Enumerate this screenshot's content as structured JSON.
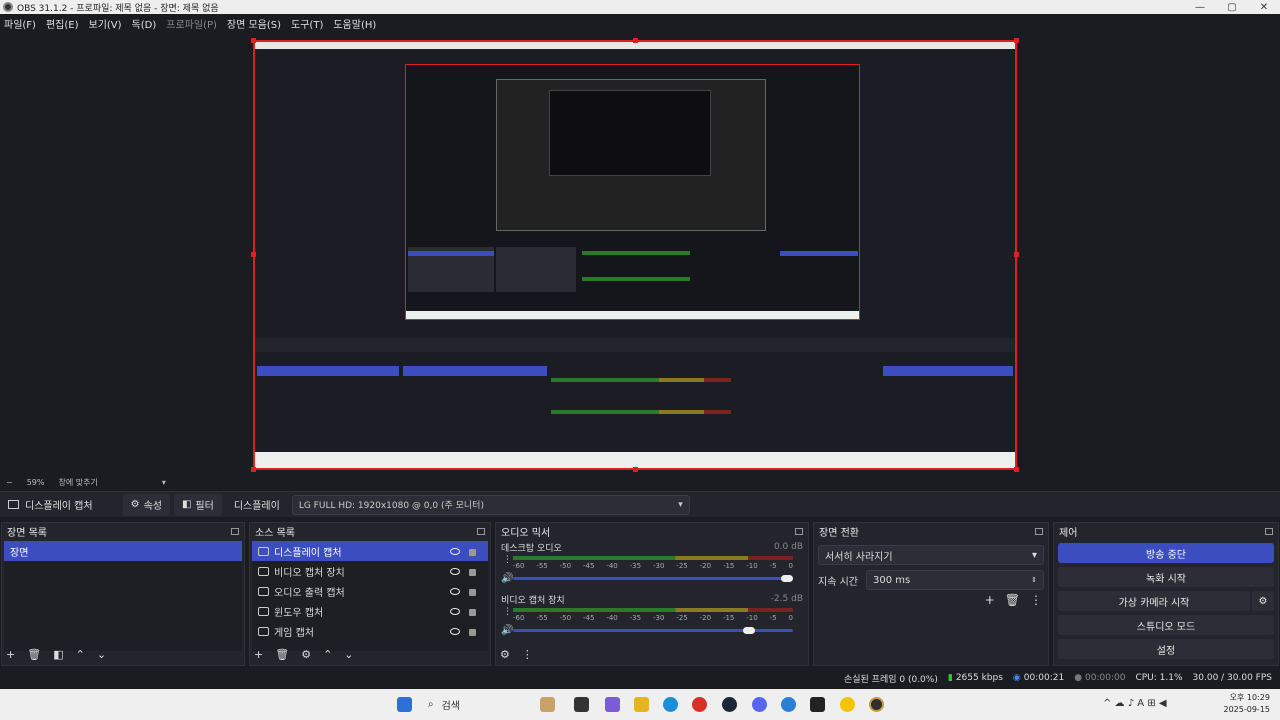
{
  "window": {
    "title": "OBS 31.1.2 - 프로파일: 제목 없음 - 장면: 제목 없음"
  },
  "menu": [
    {
      "label": "파일(F)",
      "dim": false
    },
    {
      "label": "편집(E)",
      "dim": false
    },
    {
      "label": "보기(V)",
      "dim": false
    },
    {
      "label": "독(D)",
      "dim": false
    },
    {
      "label": "프로파일(P)",
      "dim": true
    },
    {
      "label": "장면 모음(S)",
      "dim": false
    },
    {
      "label": "도구(T)",
      "dim": false
    },
    {
      "label": "도움말(H)",
      "dim": false
    }
  ],
  "zoom": {
    "value": "59%",
    "mode": "창에 맞추기"
  },
  "source_bar": {
    "source_name": "디스플레이 캡처",
    "properties": "속성",
    "filters": "필터",
    "display_label": "디스플레이",
    "display_value": "LG FULL HD: 1920x1080 @ 0,0 (주 모니터)"
  },
  "scenes": {
    "title": "장면 목록",
    "items": [
      "장면"
    ]
  },
  "sources": {
    "title": "소스 목록",
    "items": [
      "디스플레이 캡처",
      "비디오 캡처 장치",
      "오디오 출력 캡처",
      "윈도우 캡처",
      "게임 캡처"
    ],
    "icons": [
      "monitor-icon",
      "camera-icon",
      "speaker-icon",
      "window-icon",
      "gamepad-icon"
    ]
  },
  "mixer": {
    "title": "오디오 믹서",
    "channels": [
      {
        "name": "데스크탑 오디오",
        "db": "0.0 dB",
        "volume": 1.0
      },
      {
        "name": "비디오 캡처 장치",
        "db": "-2.5 dB",
        "volume": 0.86
      }
    ],
    "ticks": [
      "-60",
      "-55",
      "-50",
      "-45",
      "-40",
      "-35",
      "-30",
      "-25",
      "-20",
      "-15",
      "-10",
      "-5",
      "0"
    ]
  },
  "transitions": {
    "title": "장면 전환",
    "type": "서서히 사라지기",
    "duration_label": "지속 시간",
    "duration": "300 ms"
  },
  "controls": {
    "title": "제어",
    "stop_stream": "방송 중단",
    "start_record": "녹화 시작",
    "virtual_cam": "가상 카메라 시작",
    "studio_mode": "스튜디오 모드",
    "settings": "설정"
  },
  "status": {
    "dropped": "손실된 프레임 0 (0.0%)",
    "bitrate": "2655 kbps",
    "stream_time": "00:00:21",
    "rec_time": "00:00:00",
    "cpu": "CPU: 1.1%",
    "fps": "30.00 / 30.00 FPS"
  },
  "taskbar": {
    "search": "검색",
    "time": "오후 10:29",
    "date": "2025-09-15"
  },
  "colors": {
    "accent": "#3b4dbf",
    "selection_border": "#e02020",
    "bg": "#1b1c22"
  }
}
